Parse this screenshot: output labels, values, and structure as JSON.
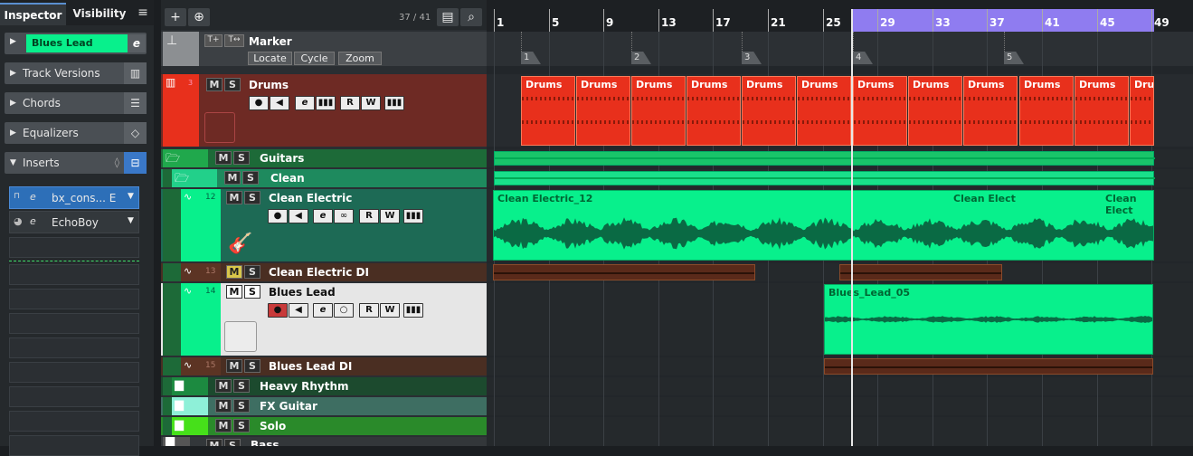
{
  "inspector": {
    "tabs": [
      "Inspector",
      "Visibility"
    ],
    "menu_icon": "hamburger-icon",
    "track_name": "Blues Lead",
    "sections": [
      {
        "label": "Track Versions",
        "icon": "track-versions-icon"
      },
      {
        "label": "Chords",
        "icon": "sliders-icon"
      },
      {
        "label": "Equalizers",
        "icon": "eq-icon"
      },
      {
        "label": "Inserts",
        "icon": "inserts-icon"
      }
    ],
    "inserts": [
      "bx_cons... E",
      "EchoBoy"
    ]
  },
  "tracklist": {
    "counter": "37 / 41",
    "tracks": {
      "marker": {
        "name": "Marker",
        "buttons": [
          "Locate",
          "Cycle",
          "Zoom"
        ]
      },
      "drums": {
        "num": "3",
        "name": "Drums"
      },
      "guitars": {
        "name": "Guitars"
      },
      "clean": {
        "name": "Clean"
      },
      "clean_electric": {
        "num": "12",
        "name": "Clean Electric"
      },
      "clean_electric_di": {
        "num": "13",
        "name": "Clean Electric DI"
      },
      "blues_lead": {
        "num": "14",
        "name": "Blues Lead"
      },
      "blues_lead_di": {
        "num": "15",
        "name": "Blues Lead DI"
      },
      "heavy_rhythm": {
        "name": "Heavy Rhythm"
      },
      "fx_guitar": {
        "name": "FX Guitar"
      },
      "solo": {
        "name": "Solo"
      },
      "bass": {
        "name": "Bass"
      }
    },
    "ms": {
      "m": "M",
      "s": "S"
    },
    "ctrl": {
      "rec": "●",
      "mon": "◀",
      "edit": "e",
      "read": "R",
      "write": "W",
      "lanes": "∞",
      "midi": "▮▮▮",
      "o": "○"
    }
  },
  "ruler": {
    "bars": [
      "1",
      "5",
      "9",
      "13",
      "17",
      "21",
      "25",
      "29",
      "33",
      "37",
      "41",
      "45",
      "49"
    ]
  },
  "markers": [
    "1",
    "2",
    "3",
    "4",
    "5"
  ],
  "events": {
    "drums": "Drums",
    "clean_electric": [
      "Clean Electric_12",
      "Clean Elect",
      "Clean Elect"
    ],
    "blues_lead": "Blues_Lead_05"
  },
  "colors": {
    "drums": "#e8301c",
    "drums_track_bg": "#6e2a24",
    "green": "#08f08c",
    "group_green": "#1d7a3e",
    "cycle": "#8f7cf0"
  }
}
